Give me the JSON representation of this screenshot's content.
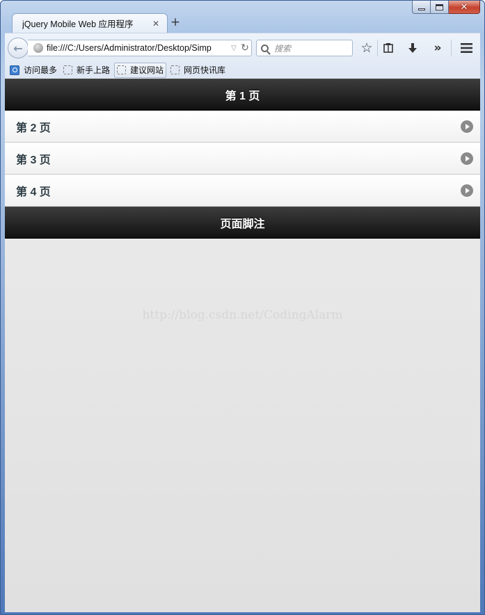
{
  "window": {
    "caption": {
      "minimize": "minimize",
      "maximize": "maximize",
      "close": "close"
    }
  },
  "tab": {
    "title": "jQuery Mobile Web 应用程序",
    "close_glyph": "✕",
    "new_tab_glyph": "+"
  },
  "navbar": {
    "url": "file:///C:/Users/Administrator/Desktop/Simp",
    "search_placeholder": "搜索",
    "icons": [
      "back-arrow-icon",
      "globe-icon",
      "dropdown-icon",
      "reload-icon",
      "search-icon",
      "star-icon",
      "reading-list-icon",
      "download-icon",
      "overflow-icon",
      "menu-icon"
    ]
  },
  "bookmarks": [
    {
      "label": "访问最多",
      "icon": "blue"
    },
    {
      "label": "新手上路",
      "icon": "dash"
    },
    {
      "label": "建议网站",
      "icon": "dash",
      "active": true
    },
    {
      "label": "网页快讯库",
      "icon": "dash"
    }
  ],
  "page": {
    "header": "第 1 页",
    "items": [
      "第 2 页",
      "第 3 页",
      "第 4 页"
    ],
    "footer": "页面脚注",
    "watermark": "http://blog.csdn.net/CodingAlarm"
  }
}
